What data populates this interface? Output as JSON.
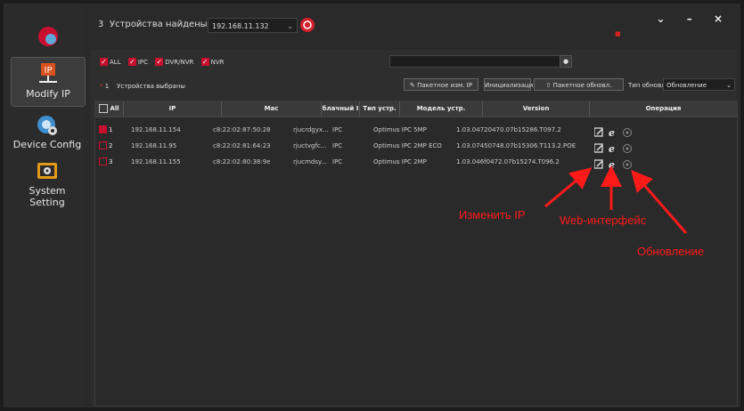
{
  "colors": {
    "accent": "#c8102e",
    "annotation": "#ff1a1a",
    "background": "#2a2a2a"
  },
  "sidebar": {
    "items": [
      {
        "label": "Modify IP",
        "icon": "ip-network-icon",
        "active": true
      },
      {
        "label": "Device Config",
        "icon": "gear-config-icon",
        "active": false
      },
      {
        "label": "System Setting",
        "icon": "settings-icon",
        "active": false
      }
    ]
  },
  "header": {
    "count": "3",
    "found_label": "Устройства найдены",
    "ip_selected": "192.168.11.132",
    "window_buttons": [
      "chevron-down-icon",
      "minimize-icon",
      "close-icon"
    ]
  },
  "filters": [
    {
      "label": "ALL",
      "checked": true
    },
    {
      "label": "IPC",
      "checked": true
    },
    {
      "label": "DVR/NVR",
      "checked": true
    },
    {
      "label": "NVR",
      "checked": true
    }
  ],
  "toolbar": {
    "selected_count": "1",
    "selected_label": "Устройства выбраны",
    "batch_ip_label": "Пакетное изм. IP",
    "init_label": "Инициализация",
    "batch_update_label": "Пакетное обновл.",
    "update_type_label": "Тип обновл.",
    "update_type_value": "Обновление"
  },
  "table": {
    "headers": [
      "All",
      "IP",
      "Mac",
      "блачный I",
      "Тип устр.",
      "Модель устр.",
      "Version",
      "Операция"
    ],
    "rows": [
      {
        "num": "1",
        "checked": true,
        "ip": "192.168.11.154",
        "mac": "c8:22:02:87:50:28",
        "cloud": "rjucrdgyx...",
        "type": "IPC",
        "model": "Optimus IPC 5MP",
        "version": "1.03.04720470.07b15286.T097.2"
      },
      {
        "num": "2",
        "checked": false,
        "ip": "192.168.11.95",
        "mac": "c8:22:02:81:64:23",
        "cloud": "rjuctvgfc...",
        "type": "IPC",
        "model": "Optimus IPC 2MP ECO",
        "version": "1.03.07450748.07b15306.T113.2.POE"
      },
      {
        "num": "3",
        "checked": false,
        "ip": "192.168.11.155",
        "mac": "c8:22:02:80:38:9e",
        "cloud": "rjucmdsy...",
        "type": "IPC",
        "model": "Optimus IPC 2MP",
        "version": "1.03.046f0472.07b15274.T096.2"
      }
    ]
  },
  "annotations": {
    "modify_ip": "Изменить IP",
    "web": "Web-интерфейс",
    "update": "Обновление"
  }
}
